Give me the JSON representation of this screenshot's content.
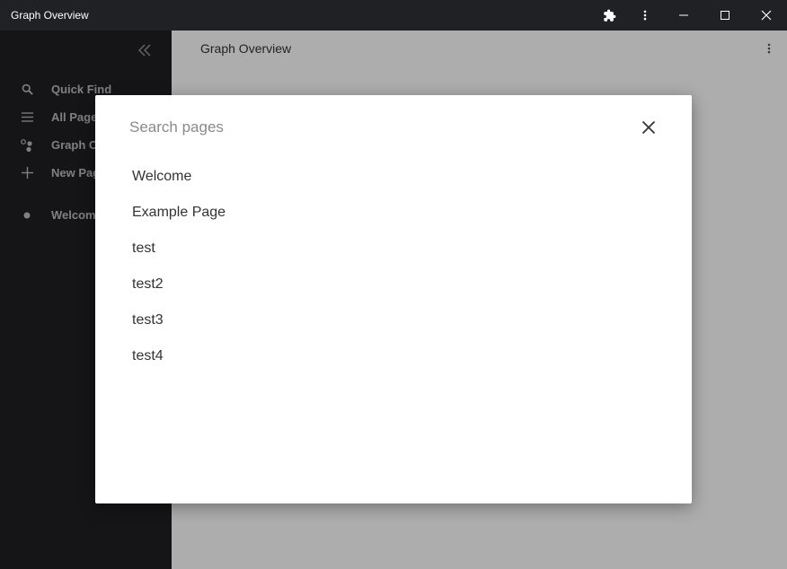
{
  "window": {
    "title": "Graph Overview",
    "icons": [
      "puzzle-icon",
      "more-vert-icon",
      "minimize-icon",
      "maximize-icon",
      "close-icon"
    ]
  },
  "sidebar": {
    "items": [
      {
        "label": "Quick Find",
        "icon": "search-icon"
      },
      {
        "label": "All Pages",
        "icon": "list-icon"
      },
      {
        "label": "Graph Overview",
        "icon": "graph-icon"
      },
      {
        "label": "New Page",
        "icon": "plus-icon"
      }
    ],
    "pages": [
      {
        "label": "Welcome",
        "icon": "dot-icon"
      }
    ]
  },
  "main": {
    "title": "Graph Overview"
  },
  "dialog": {
    "search": {
      "placeholder": "Search pages",
      "value": ""
    },
    "results": [
      "Welcome",
      "Example Page",
      "test",
      "test2",
      "test3",
      "test4"
    ]
  },
  "colors": {
    "titlebar": "#202124",
    "sidebar": "#1f1f22",
    "sidebar_text": "#bdbdbd",
    "overlay": "rgba(0,0,0,0.32)",
    "dialog": "#ffffff"
  }
}
